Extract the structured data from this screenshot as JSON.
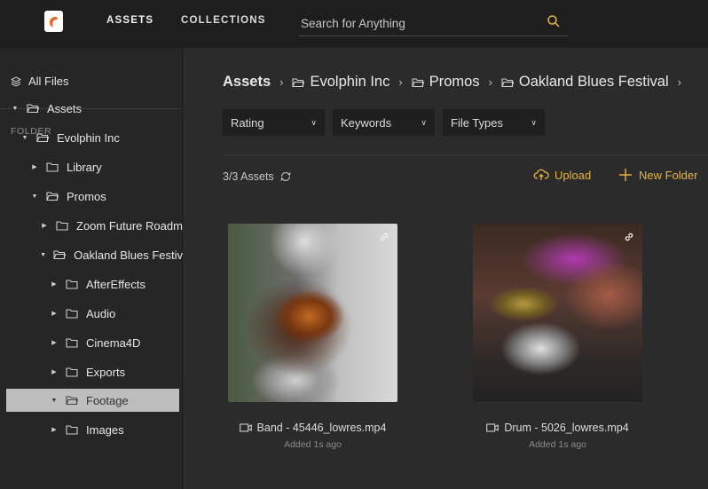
{
  "topbar": {
    "nav": [
      {
        "label": "ASSETS",
        "active": true
      },
      {
        "label": "COLLECTIONS",
        "active": false
      }
    ],
    "search": {
      "placeholder": "Search for Anything"
    }
  },
  "sidebar": {
    "all_files": "All Files",
    "section_label": "FOLDER",
    "tree": [
      {
        "label": "Assets",
        "expanded": true
      },
      {
        "label": "Evolphin Inc",
        "expanded": true
      },
      {
        "label": "Library",
        "expanded": false
      },
      {
        "label": "Promos",
        "expanded": true
      },
      {
        "label": "Zoom Future Roadm",
        "expanded": false
      },
      {
        "label": "Oakland Blues Festiv",
        "expanded": true
      },
      {
        "label": "AfterEffects",
        "expanded": false
      },
      {
        "label": "Audio",
        "expanded": false
      },
      {
        "label": "Cinema4D",
        "expanded": false
      },
      {
        "label": "Exports",
        "expanded": false
      },
      {
        "label": "Footage",
        "expanded": true,
        "selected": true
      },
      {
        "label": "Images",
        "expanded": false
      }
    ]
  },
  "main": {
    "breadcrumb": [
      "Assets",
      "Evolphin Inc",
      "Promos",
      "Oakland Blues Festival"
    ],
    "filters": [
      "Rating",
      "Keywords",
      "File Types"
    ],
    "count": "3/3 Assets",
    "upload_label": "Upload",
    "new_folder_label": "New Folder",
    "assets": [
      {
        "name": "Band - 45446_lowres.mp4",
        "added": "Added 1s ago"
      },
      {
        "name": "Drum - 5026_lowres.mp4",
        "added": "Added 1s ago"
      }
    ]
  },
  "colors": {
    "accent": "#e8b53c",
    "topbar": "#1e1e1e",
    "sidebar": "#262626",
    "main": "#2b2b2b"
  }
}
